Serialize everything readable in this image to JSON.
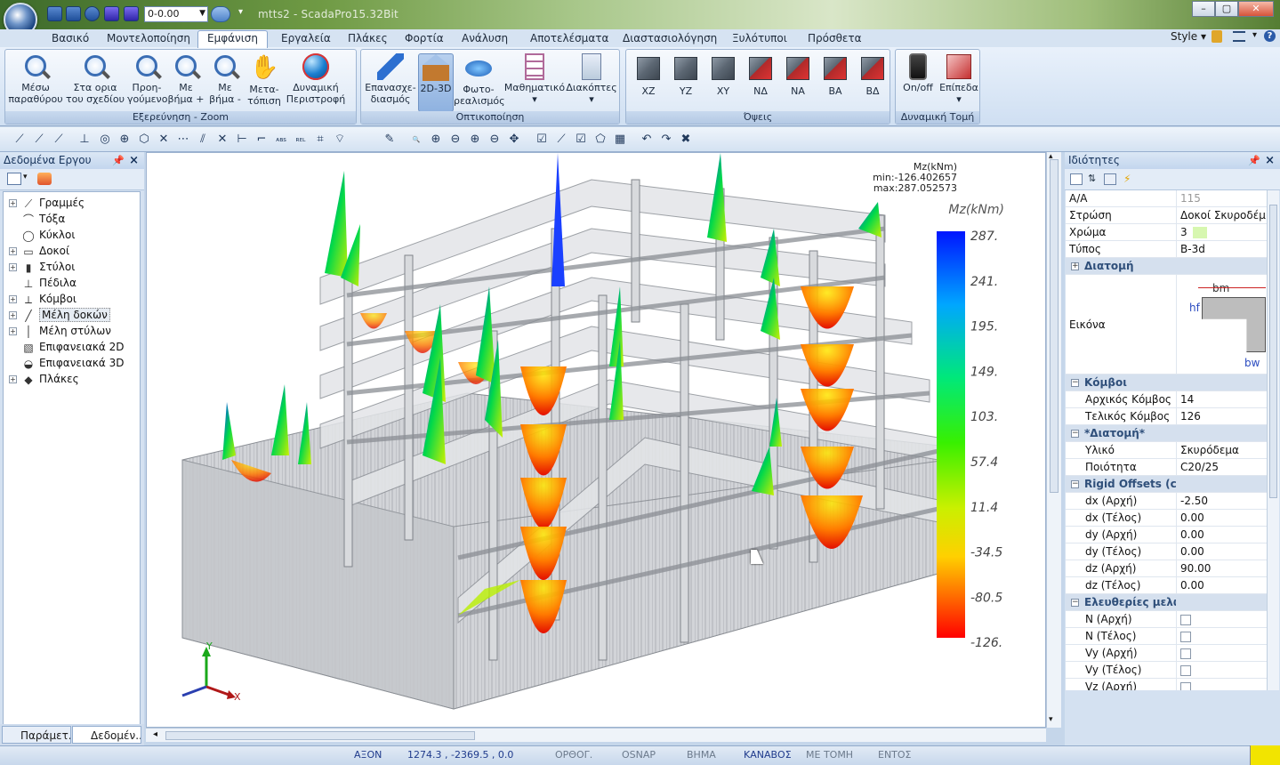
{
  "window": {
    "title": "mtts2 - ScadaPro15.32Bit",
    "level_value": "0-0.00",
    "buttons": [
      "–",
      "▢",
      "✕"
    ]
  },
  "ribbon_tabs": [
    {
      "label": "Βασικό",
      "active": false
    },
    {
      "label": "Μοντελοποίηση",
      "active": false
    },
    {
      "label": "Εμφάνιση",
      "active": true
    },
    {
      "label": "Εργαλεία",
      "active": false
    },
    {
      "label": "Πλάκες",
      "active": false
    },
    {
      "label": "Φορτία",
      "active": false
    },
    {
      "label": "Ανάλυση",
      "active": false
    },
    {
      "label": "Αποτελέσματα",
      "active": false
    },
    {
      "label": "Διαστασιολόγηση",
      "active": false
    },
    {
      "label": "Ξυλότυποι",
      "active": false
    },
    {
      "label": "Πρόσθετα",
      "active": false
    }
  ],
  "ribbon_right": {
    "style_label": "Style",
    "style_arrow": "▾"
  },
  "groups": {
    "zoom": {
      "label": "Εξερεύνηση - Zoom",
      "buttons": [
        {
          "l1": "Μέσω",
          "l2": "παραθύρου",
          "icon": "zoom-window-icon"
        },
        {
          "l1": "Στα ορια",
          "l2": "του σχεδίου",
          "icon": "zoom-extents-icon"
        },
        {
          "l1": "Προη-",
          "l2": "γούμενο",
          "icon": "zoom-previous-icon"
        },
        {
          "l1": "Με",
          "l2": "βήμα +",
          "icon": "zoom-in-icon"
        },
        {
          "l1": "Με",
          "l2": "βήμα -",
          "icon": "zoom-out-icon"
        },
        {
          "l1": "Μετα-",
          "l2": "τόπιση",
          "icon": "pan-hand-icon"
        },
        {
          "l1": "Δυναμική",
          "l2": "Περιστροφή",
          "icon": "orbit-globe-icon"
        }
      ]
    },
    "view": {
      "label": "Οπτικοποίηση",
      "buttons": [
        {
          "l1": "Επανασχε-",
          "l2": "διασμός",
          "icon": "redraw-pencil-icon"
        },
        {
          "l1": "2D-3D",
          "l2": "",
          "icon": "house-3d-icon"
        },
        {
          "l1": "Φωτο-",
          "l2": "ρεαλισμός",
          "icon": "photorealism-icon"
        },
        {
          "l1": "Μαθηματικό",
          "l2": "▾",
          "icon": "math-model-icon"
        },
        {
          "l1": "Διακόπτες",
          "l2": "▾",
          "icon": "switches-icon"
        }
      ]
    },
    "views": {
      "label": "Όψεις",
      "buttons": [
        "XZ",
        "YZ",
        "XY",
        "ΝΔ",
        "ΝΑ",
        "ΒΑ",
        "ΒΔ"
      ]
    },
    "section": {
      "label": "Δυναμική Τομή",
      "buttons": [
        {
          "l1": "On/off",
          "l2": "",
          "icon": "onoff-device-icon"
        },
        {
          "l1": "Επίπεδα",
          "l2": "▾",
          "icon": "planes-cube-icon"
        }
      ]
    }
  },
  "left_panel": {
    "title": "Δεδομένα Εργου",
    "tree": [
      {
        "label": "Γραμμές",
        "expandable": true,
        "icon": "lines-icon",
        "glyph": "⟋"
      },
      {
        "label": "Τόξα",
        "expandable": false,
        "icon": "arcs-icon",
        "glyph": "⌒"
      },
      {
        "label": "Κύκλοι",
        "expandable": false,
        "icon": "circles-icon",
        "glyph": "◯"
      },
      {
        "label": "Δοκοί",
        "expandable": true,
        "icon": "beams-icon",
        "glyph": "▭"
      },
      {
        "label": "Στύλοι",
        "expandable": true,
        "icon": "columns-icon",
        "glyph": "▮"
      },
      {
        "label": "Πέδιλα",
        "expandable": false,
        "icon": "footings-icon",
        "glyph": "⊥"
      },
      {
        "label": "Κόμβοι",
        "expandable": true,
        "icon": "nodes-icon",
        "glyph": "⟂"
      },
      {
        "label": "Μέλη δοκών",
        "expandable": true,
        "icon": "beam-members-icon",
        "glyph": "╱",
        "selected": true
      },
      {
        "label": "Μέλη στύλων",
        "expandable": true,
        "icon": "column-members-icon",
        "glyph": "│"
      },
      {
        "label": "Επιφανειακά 2D",
        "expandable": false,
        "icon": "surface-2d-icon",
        "glyph": "▧"
      },
      {
        "label": "Επιφανειακά 3D",
        "expandable": false,
        "icon": "surface-3d-icon",
        "glyph": "◒"
      },
      {
        "label": "Πλάκες",
        "expandable": true,
        "icon": "slabs-icon",
        "glyph": "◆"
      }
    ],
    "tabs": [
      {
        "label": "Παράμετ...",
        "active": false
      },
      {
        "label": "Δεδομέν...",
        "active": true
      }
    ]
  },
  "viewport": {
    "info_title": "Mz(kNm)",
    "info_min": "min:-126.402657",
    "info_max": "max:287.052573",
    "legend_title": "Mz(kNm)",
    "legend_ticks": [
      "287.",
      "241.",
      "195.",
      "149.",
      "103.",
      "57.4",
      "11.4",
      "-34.5",
      "-80.5",
      "-126."
    ],
    "axis_labels": {
      "x": "X",
      "y": "Y"
    }
  },
  "right_panel": {
    "title": "Ιδιότητες",
    "rows": [
      {
        "type": "kv",
        "k": "Α/Α",
        "v": "115",
        "muted": true
      },
      {
        "type": "kv",
        "k": "Στρώση",
        "v": "Δοκοί Σκυροδέμ..."
      },
      {
        "type": "kv",
        "k": "Χρώμα",
        "v": "3",
        "swatch": "#d7f7b0"
      },
      {
        "type": "kv",
        "k": "Τύπος",
        "v": "B-3d"
      },
      {
        "type": "cat",
        "k": "Διατομή",
        "m": "+"
      },
      {
        "type": "img",
        "k": "Εικόνα",
        "bm": "bm",
        "hf": "hf",
        "bw": "bw"
      },
      {
        "type": "cat",
        "k": "Κόμβοι",
        "m": "−"
      },
      {
        "type": "sub",
        "k": "Αρχικός Κόμβος",
        "v": "14"
      },
      {
        "type": "sub",
        "k": "Τελικός Κόμβος",
        "v": "126"
      },
      {
        "type": "cat",
        "k": "*Διατομή*",
        "m": "−"
      },
      {
        "type": "sub",
        "k": "Υλικό",
        "v": "Σκυρόδεμα"
      },
      {
        "type": "sub",
        "k": "Ποιότητα",
        "v": "C20/25"
      },
      {
        "type": "cat",
        "k": "Rigid Offsets (cm)",
        "m": "−"
      },
      {
        "type": "sub",
        "k": "dx (Αρχή)",
        "v": "-2.50"
      },
      {
        "type": "sub",
        "k": "dx (Τέλος)",
        "v": "0.00"
      },
      {
        "type": "sub",
        "k": "dy (Αρχή)",
        "v": "0.00"
      },
      {
        "type": "sub",
        "k": "dy (Τέλος)",
        "v": "0.00"
      },
      {
        "type": "sub",
        "k": "dz (Αρχή)",
        "v": "90.00"
      },
      {
        "type": "sub",
        "k": "dz (Τέλος)",
        "v": "0.00"
      },
      {
        "type": "cat",
        "k": "Ελευθερίες μελών",
        "m": "−"
      },
      {
        "type": "chk",
        "k": "N (Αρχή)"
      },
      {
        "type": "chk",
        "k": "N (Τέλος)"
      },
      {
        "type": "chk",
        "k": "Vy (Αρχή)"
      },
      {
        "type": "chk",
        "k": "Vy (Τέλος)"
      },
      {
        "type": "chk",
        "k": "Vz (Αρχή)"
      }
    ]
  },
  "status": {
    "items": [
      {
        "label": "ΑΞΟΝ",
        "on": true
      },
      {
        "label": "1274.3 , -2369.5 , 0.0",
        "on": true
      },
      {
        "label": "ΟΡΘΟΓ.",
        "on": false
      },
      {
        "label": "OSNAP",
        "on": false
      },
      {
        "label": "ΒΗΜΑ",
        "on": false
      },
      {
        "label": "ΚΑΝΑΒΟΣ",
        "on": true
      },
      {
        "label": "ΜΕ ΤΟΜΗ",
        "on": false
      },
      {
        "label": "ΕΝΤΟΣ",
        "on": false
      }
    ]
  },
  "colors": {
    "accent": "#2f5ea8",
    "panel": "#d4e1f1",
    "moment_max": "#0018ff",
    "moment_min": "#ff0000"
  }
}
